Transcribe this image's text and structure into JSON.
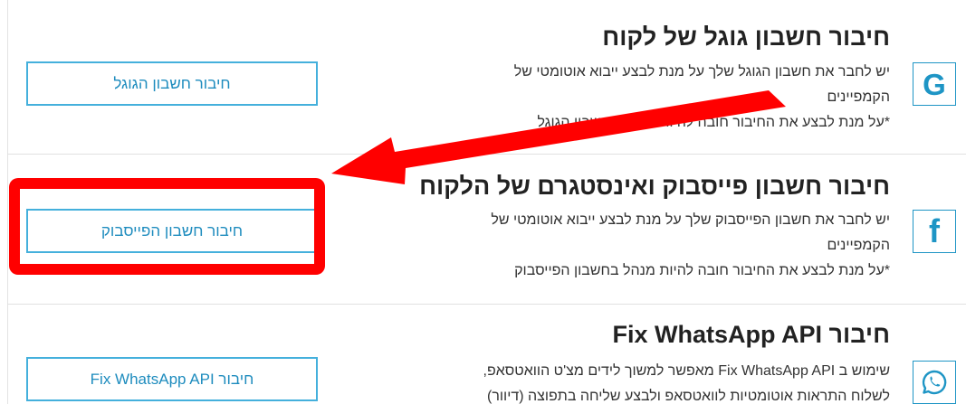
{
  "google": {
    "title": "חיבור חשבון גוגל של לקוח",
    "desc_line1": "יש לחבר את חשבון הגוגל שלך על מנת לבצע ייבוא אוטומטי של",
    "desc_line2": "הקמפיינים",
    "note": "*על מנת לבצע את החיבור חובה להיות מנהל בחשבון הגוגל",
    "button_label": "חיבור חשבון הגוגל",
    "icon_glyph": "G",
    "icon": "google-icon"
  },
  "facebook": {
    "title": "חיבור חשבון פייסבוק ואינסטגרם של הלקוח",
    "desc_line1": "יש לחבר את חשבון הפייסבוק שלך על מנת לבצע ייבוא אוטומטי של",
    "desc_line2": "הקמפיינים",
    "note": "*על מנת לבצע את החיבור חובה להיות מנהל בחשבון הפייסבוק",
    "button_label": "חיבור חשבון הפייסבוק",
    "icon_glyph": "f",
    "icon": "facebook-icon"
  },
  "whatsapp": {
    "title": "חיבור Fix WhatsApp API",
    "desc_line1": "שימוש ב Fix WhatsApp API מאפשר למשוך לידים מצ'ט הוואטסאפ,",
    "desc_line2": "לשלוח התראות אוטומטיות לוואטסאפ ולבצע שליחה בתפוצה (דיוור)",
    "button_label": "חיבור Fix WhatsApp API",
    "icon": "whatsapp-icon"
  },
  "colors": {
    "accent": "#1e95c5",
    "annotation": "#ff0000"
  }
}
